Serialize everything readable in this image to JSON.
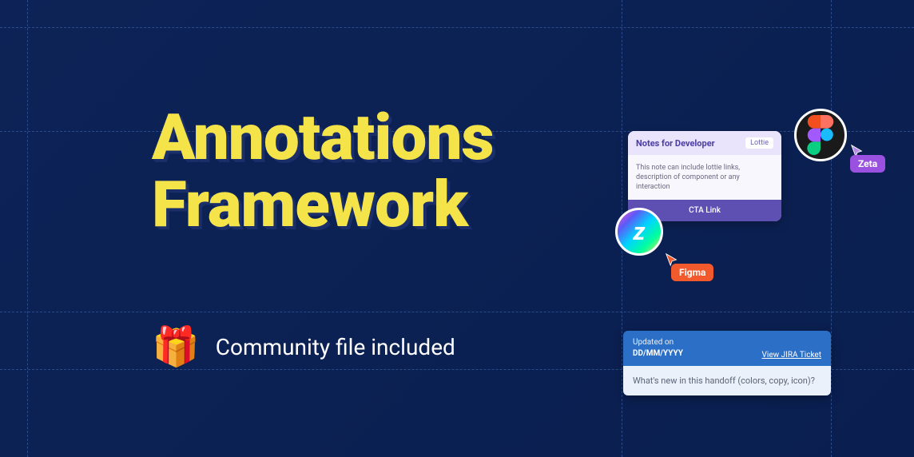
{
  "headline": {
    "line1": "Annotations",
    "line2": "Framework"
  },
  "sub": {
    "icon": "🎁",
    "text": "Community file included"
  },
  "note": {
    "title": "Notes for Developer",
    "tag": "Lottie",
    "body": "This note can include lottie links, description of component or any interaction",
    "cta": "CTA Link"
  },
  "cursor_tags": {
    "zeta": "Zeta",
    "figma": "Figma"
  },
  "z_avatar": {
    "letter": "z"
  },
  "jira": {
    "updated_label": "Updated on",
    "updated_value": "DD/MM/YYYY",
    "link": "View JIRA Ticket",
    "body": "What's new in this handoff (colors, copy, icon)?"
  }
}
